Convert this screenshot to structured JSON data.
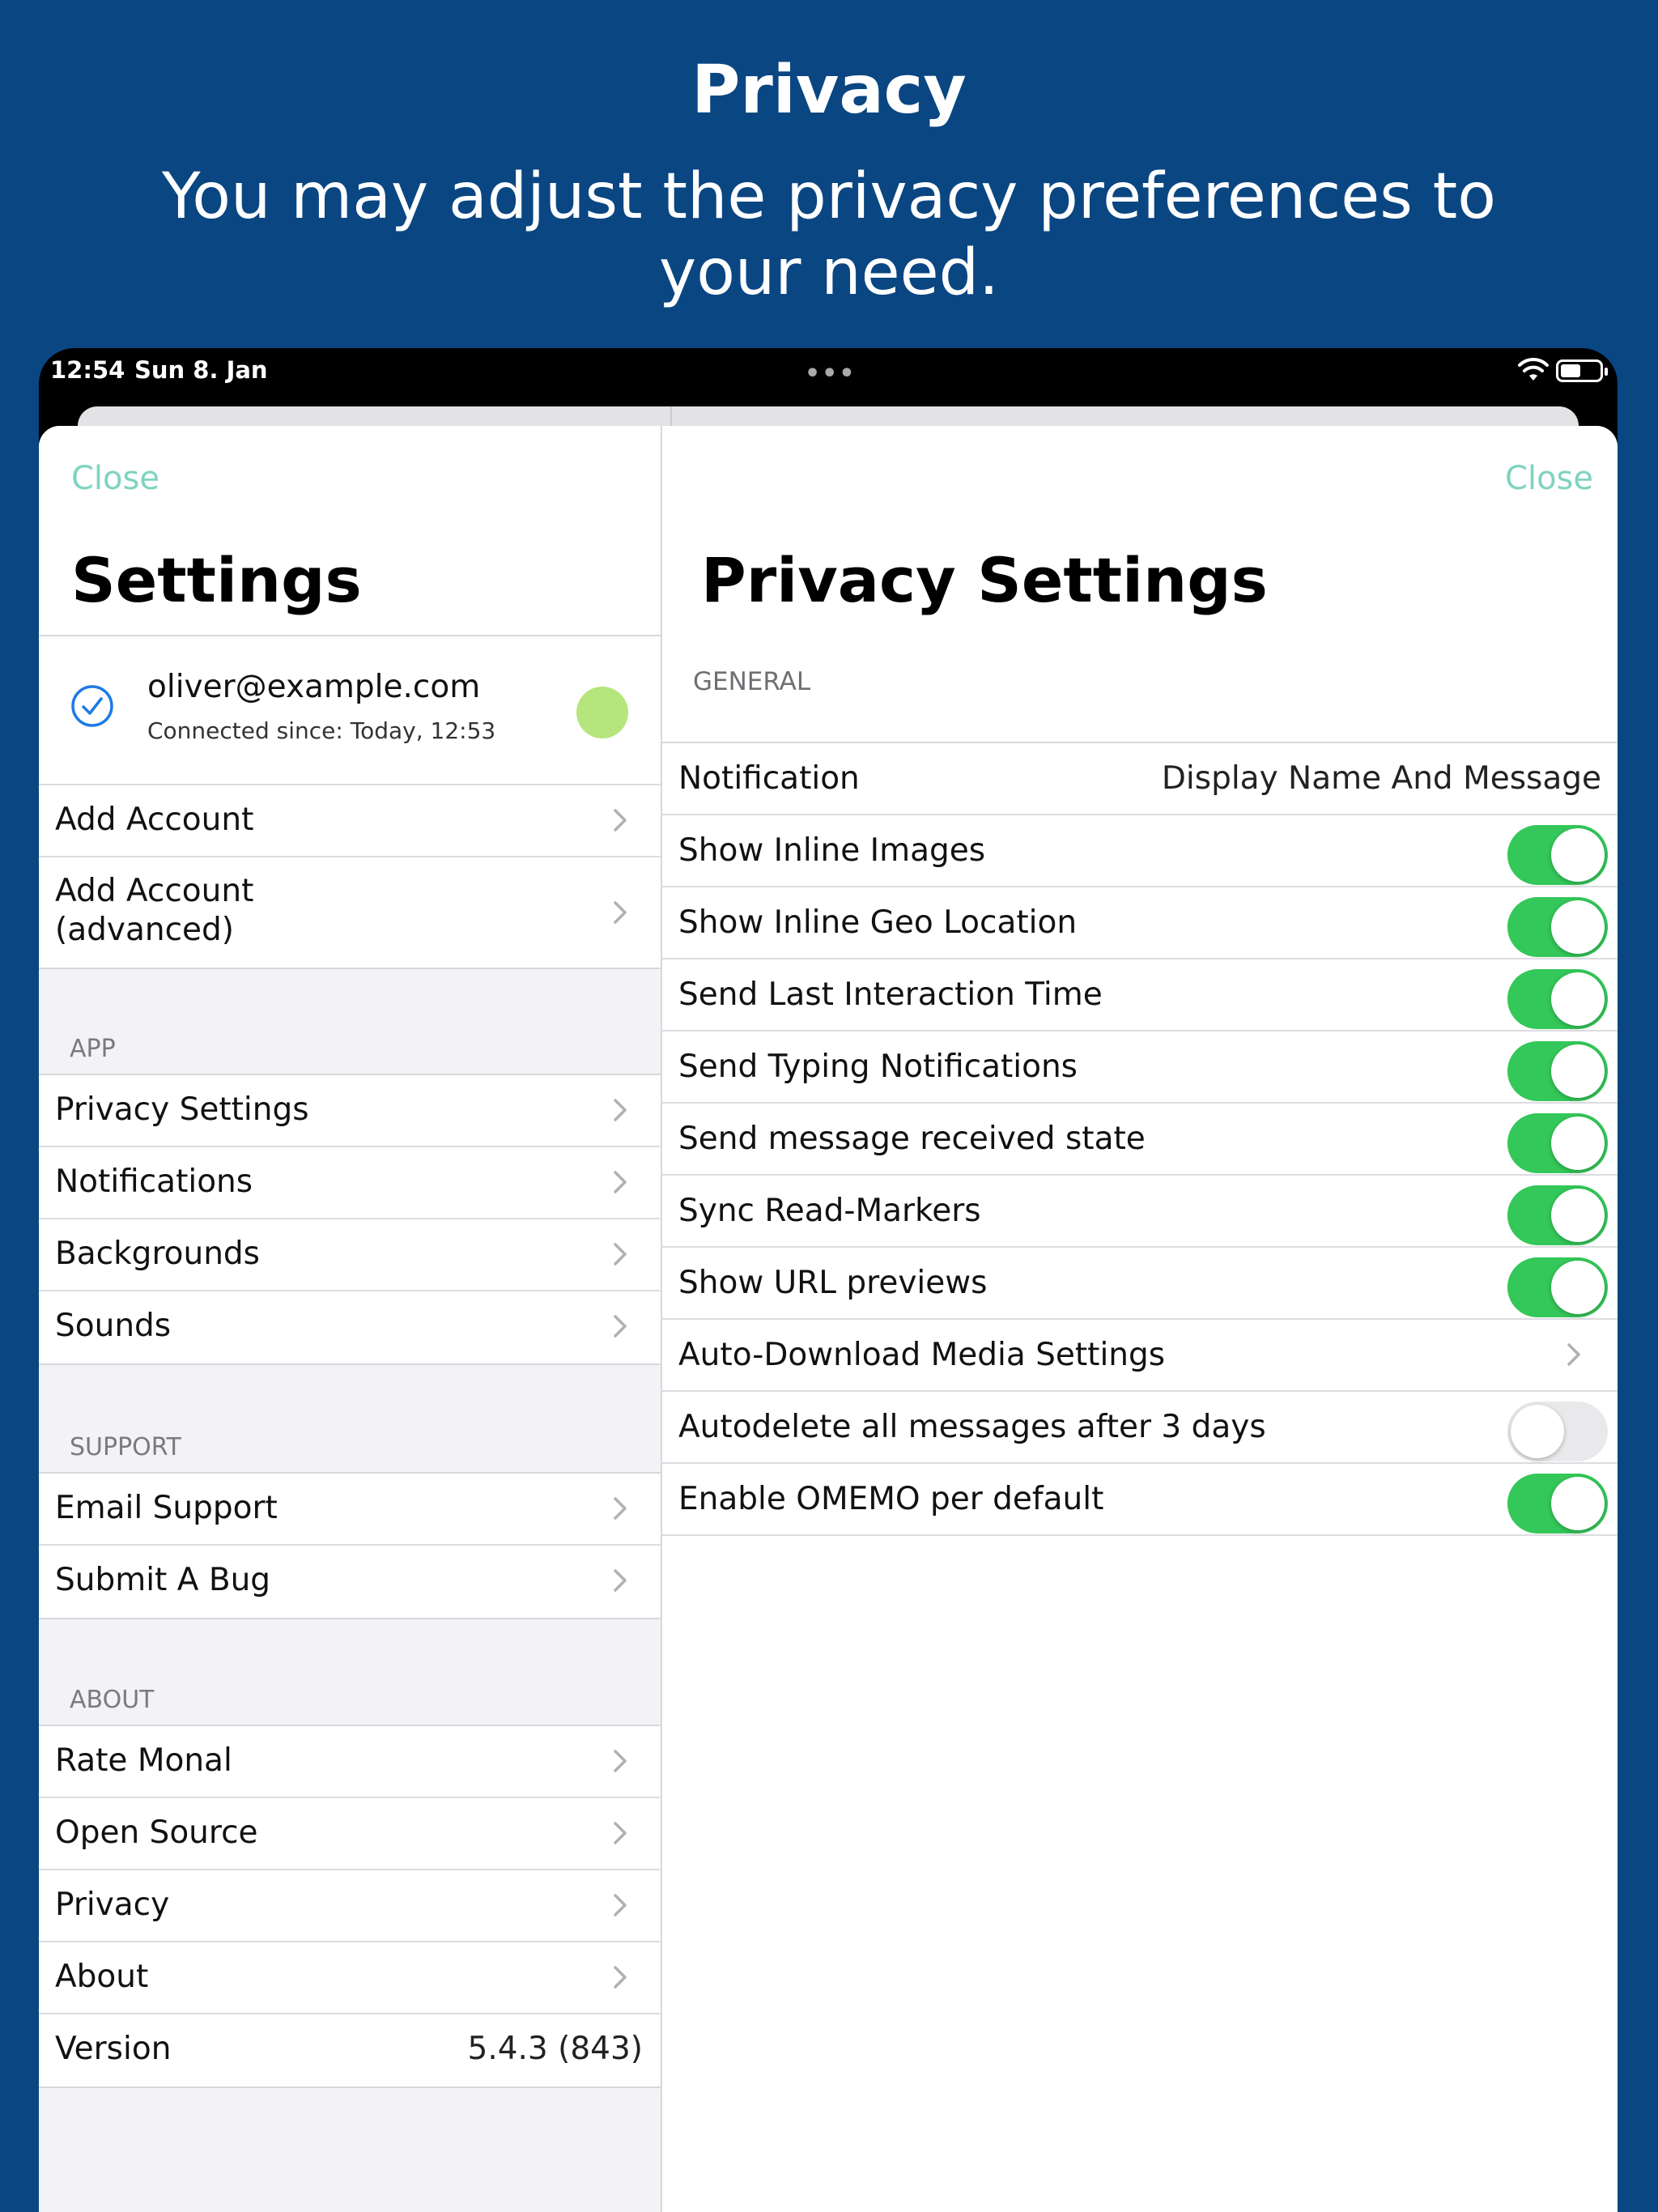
{
  "banner": {
    "title": "Privacy",
    "subtitle": "You may adjust the privacy preferences to your need."
  },
  "statusbar": {
    "time": "12:54",
    "date": "Sun 8. Jan",
    "multitask_dots": "•••",
    "icons": [
      "wifi-icon",
      "battery-icon"
    ]
  },
  "colors": {
    "background": "#0a4682",
    "accent_link": "#7fd3bf",
    "toggle_on": "#34c759",
    "toggle_off": "#e9e9eb",
    "status_dot": "#b5e57c"
  },
  "settings": {
    "close_label": "Close",
    "title": "Settings",
    "account": {
      "email": "oliver@example.com",
      "status": "Connected since: Today, 12:53"
    },
    "account_items": [
      {
        "label": "Add Account"
      },
      {
        "label": "Add Account\n(advanced)"
      }
    ],
    "app_header": "APP",
    "app_items": [
      {
        "label": "Privacy Settings"
      },
      {
        "label": "Notifications"
      },
      {
        "label": "Backgrounds"
      },
      {
        "label": "Sounds"
      }
    ],
    "support_header": "SUPPORT",
    "support_items": [
      {
        "label": "Email Support"
      },
      {
        "label": "Submit A Bug"
      }
    ],
    "about_header": "ABOUT",
    "about_items": [
      {
        "label": "Rate Monal"
      },
      {
        "label": "Open Source"
      },
      {
        "label": "Privacy"
      },
      {
        "label": "About"
      }
    ],
    "version_label": "Version",
    "version_value": "5.4.3 (843)"
  },
  "privacy": {
    "close_label": "Close",
    "title": "Privacy Settings",
    "general_header": "GENERAL",
    "notification_label": "Notification",
    "notification_value": "Display Name And Message",
    "toggles": [
      {
        "label": "Show Inline Images",
        "on": true
      },
      {
        "label": "Show Inline Geo Location",
        "on": true
      },
      {
        "label": "Send Last Interaction Time",
        "on": true
      },
      {
        "label": "Send Typing Notifications",
        "on": true
      },
      {
        "label": "Send message received state",
        "on": true
      },
      {
        "label": "Sync Read-Markers",
        "on": true
      },
      {
        "label": "Show URL previews",
        "on": true
      }
    ],
    "auto_download_label": "Auto-Download Media Settings",
    "autodelete": {
      "label": "Autodelete all messages after 3 days",
      "on": false
    },
    "omemo": {
      "label": "Enable OMEMO per default",
      "on": true
    }
  }
}
